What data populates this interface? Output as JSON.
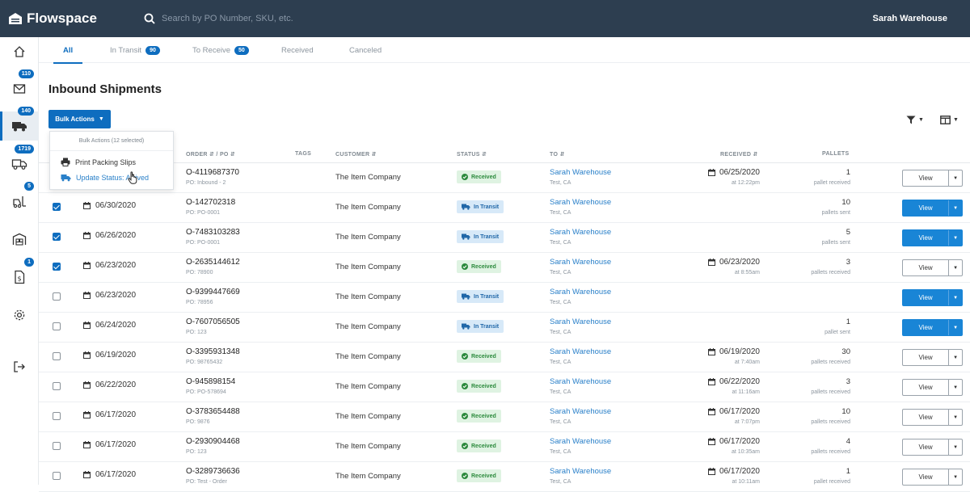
{
  "app": {
    "name": "Flowspace",
    "user": "Sarah Warehouse"
  },
  "search": {
    "placeholder": "Search by PO Number, SKU, etc."
  },
  "sidebar": {
    "items": [
      {
        "name": "home-icon",
        "badge": ""
      },
      {
        "name": "mail-icon",
        "badge": "110"
      },
      {
        "name": "truck-inbound-icon",
        "badge": "140"
      },
      {
        "name": "delivery-truck-icon",
        "badge": "1719"
      },
      {
        "name": "forklift-icon",
        "badge": "5"
      },
      {
        "name": "warehouse-icon",
        "badge": ""
      },
      {
        "name": "billing-icon",
        "badge": "1"
      },
      {
        "name": "gear-icon",
        "badge": ""
      },
      {
        "name": "logout-icon",
        "badge": ""
      }
    ]
  },
  "tabs": [
    {
      "label": "All",
      "count": ""
    },
    {
      "label": "In Transit",
      "count": "90"
    },
    {
      "label": "To Receive",
      "count": "50"
    },
    {
      "label": "Received",
      "count": ""
    },
    {
      "label": "Canceled",
      "count": ""
    }
  ],
  "page": {
    "title": "Inbound Shipments",
    "bulk_label": "Bulk Actions"
  },
  "dropdown": {
    "header": "Bulk Actions (12 selected)",
    "items": [
      "Print Packing Slips",
      "Update Status: Arrived"
    ]
  },
  "columns": {
    "order": "ORDER",
    "po": "PO",
    "tags": "TAGS",
    "customer": "CUSTOMER",
    "status": "STATUS",
    "to": "TO",
    "received": "RECEIVED",
    "pallets": "PALLETS"
  },
  "colors": {
    "primary": "#0e6dbf",
    "topbar": "#2d3e50",
    "received_bg": "#dff3e2",
    "transit_bg": "#d7e9f8"
  },
  "rows": [
    {
      "checked": false,
      "created": "",
      "order": "O-4119687370",
      "po": "PO: Inbound - 2",
      "customer": "The Item Company",
      "status": "Received",
      "to": "Sarah Warehouse",
      "loc": "Test, CA",
      "recv_date": "06/25/2020",
      "recv_time": "at 12:22pm",
      "pallets": "1",
      "pallet_label": "pallet received",
      "view": "View",
      "primary": false
    },
    {
      "checked": true,
      "created": "06/30/2020",
      "order": "O-142702318",
      "po": "PO: PO-0001",
      "customer": "The Item Company",
      "status": "In Transit",
      "to": "Sarah Warehouse",
      "loc": "Test, CA",
      "recv_date": "",
      "recv_time": "",
      "pallets": "10",
      "pallet_label": "pallets sent",
      "view": "View",
      "primary": true
    },
    {
      "checked": true,
      "created": "06/26/2020",
      "order": "O-7483103283",
      "po": "PO: PO-0001",
      "customer": "The Item Company",
      "status": "In Transit",
      "to": "Sarah Warehouse",
      "loc": "Test, CA",
      "recv_date": "",
      "recv_time": "",
      "pallets": "5",
      "pallet_label": "pallets sent",
      "view": "View",
      "primary": true
    },
    {
      "checked": true,
      "created": "06/23/2020",
      "order": "O-2635144612",
      "po": "PO: 78900",
      "customer": "The Item Company",
      "status": "Received",
      "to": "Sarah Warehouse",
      "loc": "Test, CA",
      "recv_date": "06/23/2020",
      "recv_time": "at 8:55am",
      "pallets": "3",
      "pallet_label": "pallets received",
      "view": "View",
      "primary": false
    },
    {
      "checked": false,
      "created": "06/23/2020",
      "order": "O-9399447669",
      "po": "PO: 78956",
      "customer": "The Item Company",
      "status": "In Transit",
      "to": "Sarah Warehouse",
      "loc": "Test, CA",
      "recv_date": "",
      "recv_time": "",
      "pallets": "",
      "pallet_label": "",
      "view": "View",
      "primary": true
    },
    {
      "checked": false,
      "created": "06/24/2020",
      "order": "O-7607056505",
      "po": "PO: 123",
      "customer": "The Item Company",
      "status": "In Transit",
      "to": "Sarah Warehouse",
      "loc": "Test, CA",
      "recv_date": "",
      "recv_time": "",
      "pallets": "1",
      "pallet_label": "pallet sent",
      "view": "View",
      "primary": true
    },
    {
      "checked": false,
      "created": "06/19/2020",
      "order": "O-3395931348",
      "po": "PO: 98765432",
      "customer": "The Item Company",
      "status": "Received",
      "to": "Sarah Warehouse",
      "loc": "Test, CA",
      "recv_date": "06/19/2020",
      "recv_time": "at 7:40am",
      "pallets": "30",
      "pallet_label": "pallets received",
      "view": "View",
      "primary": false
    },
    {
      "checked": false,
      "created": "06/22/2020",
      "order": "O-945898154",
      "po": "PO: PO-578694",
      "customer": "The Item Company",
      "status": "Received",
      "to": "Sarah Warehouse",
      "loc": "Test, CA",
      "recv_date": "06/22/2020",
      "recv_time": "at 11:16am",
      "pallets": "3",
      "pallet_label": "pallets received",
      "view": "View",
      "primary": false
    },
    {
      "checked": false,
      "created": "06/17/2020",
      "order": "O-3783654488",
      "po": "PO: 9876",
      "customer": "The Item Company",
      "status": "Received",
      "to": "Sarah Warehouse",
      "loc": "Test, CA",
      "recv_date": "06/17/2020",
      "recv_time": "at 7:07pm",
      "pallets": "10",
      "pallet_label": "pallets received",
      "view": "View",
      "primary": false
    },
    {
      "checked": false,
      "created": "06/17/2020",
      "order": "O-2930904468",
      "po": "PO: 123",
      "customer": "The Item Company",
      "status": "Received",
      "to": "Sarah Warehouse",
      "loc": "Test, CA",
      "recv_date": "06/17/2020",
      "recv_time": "at 10:35am",
      "pallets": "4",
      "pallet_label": "pallets received",
      "view": "View",
      "primary": false
    },
    {
      "checked": false,
      "created": "06/17/2020",
      "order": "O-3289736636",
      "po": "PO: Test - Order",
      "customer": "The Item Company",
      "status": "Received",
      "to": "Sarah Warehouse",
      "loc": "Test, CA",
      "recv_date": "06/17/2020",
      "recv_time": "at 10:11am",
      "pallets": "1",
      "pallet_label": "pallet received",
      "view": "View",
      "primary": false
    }
  ]
}
